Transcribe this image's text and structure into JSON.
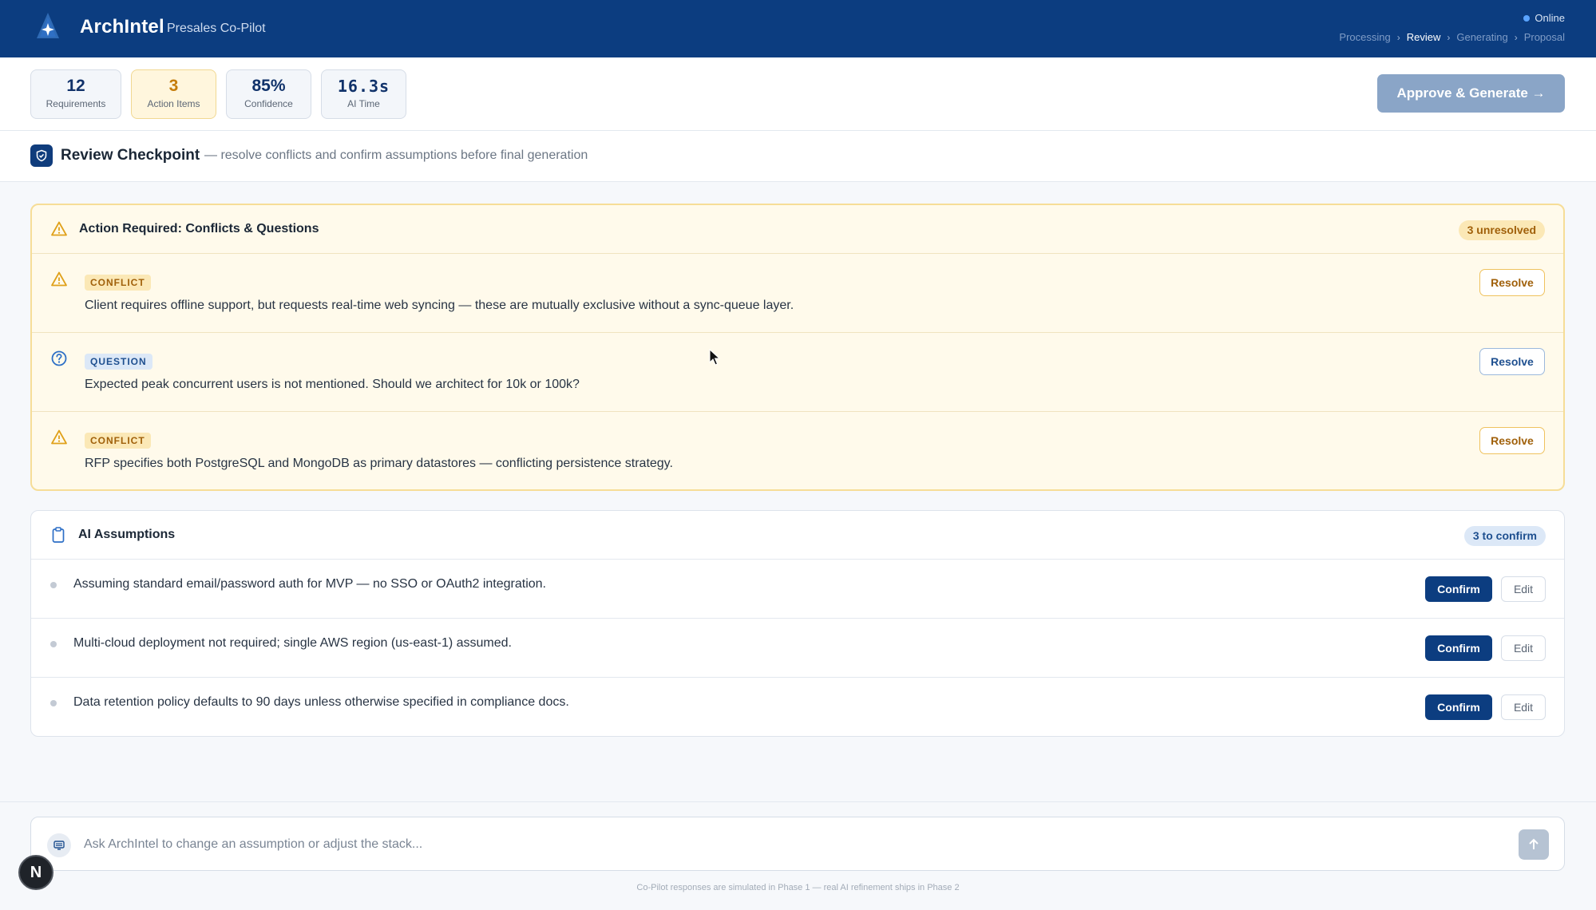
{
  "header": {
    "brand": "ArchIntel",
    "subtitle": "Presales Co-Pilot",
    "status": "Online",
    "steps": [
      "Processing",
      "Review",
      "Generating",
      "Proposal"
    ],
    "active_step": "Review"
  },
  "stats": [
    {
      "value": "12",
      "label": "Requirements"
    },
    {
      "value": "3",
      "label": "Action Items"
    },
    {
      "value": "85%",
      "label": "Confidence"
    },
    {
      "value": "16.3s",
      "label": "AI Time"
    }
  ],
  "approve_label": "Approve & Generate →",
  "checkpoint": {
    "title": "Review Checkpoint",
    "subtitle": "— resolve conflicts and confirm assumptions before final generation"
  },
  "action_required": {
    "title": "Action Required: Conflicts & Questions",
    "badge": "3 unresolved",
    "items": [
      {
        "type": "CONFLICT",
        "text": "Client requires offline support, but requests real-time web syncing — these are mutually exclusive without a sync-queue layer.",
        "button": "Resolve"
      },
      {
        "type": "QUESTION",
        "text": "Expected peak concurrent users is not mentioned. Should we architect for 10k or 100k?",
        "button": "Resolve"
      },
      {
        "type": "CONFLICT",
        "text": "RFP specifies both PostgreSQL and MongoDB as primary datastores — conflicting persistence strategy.",
        "button": "Resolve"
      }
    ]
  },
  "assumptions": {
    "title": "AI Assumptions",
    "badge": "3 to confirm",
    "confirm_label": "Confirm",
    "edit_label": "Edit",
    "items": [
      "Assuming standard email/password auth for MVP — no SSO or OAuth2 integration.",
      "Multi-cloud deployment not required; single AWS region (us-east-1) assumed.",
      "Data retention policy defaults to 90 days unless otherwise specified in compliance docs."
    ]
  },
  "chat": {
    "placeholder": "Ask ArchIntel to change an assumption or adjust the stack...",
    "footnote": "Co-Pilot responses are simulated in Phase 1 — real AI refinement ships in Phase 2"
  },
  "avatar_initial": "N",
  "colors": {
    "header": "#0c3d80",
    "accent_amber": "#a0600a",
    "accent_blue": "#1e4f8f",
    "confirm": "#0c3d80"
  }
}
